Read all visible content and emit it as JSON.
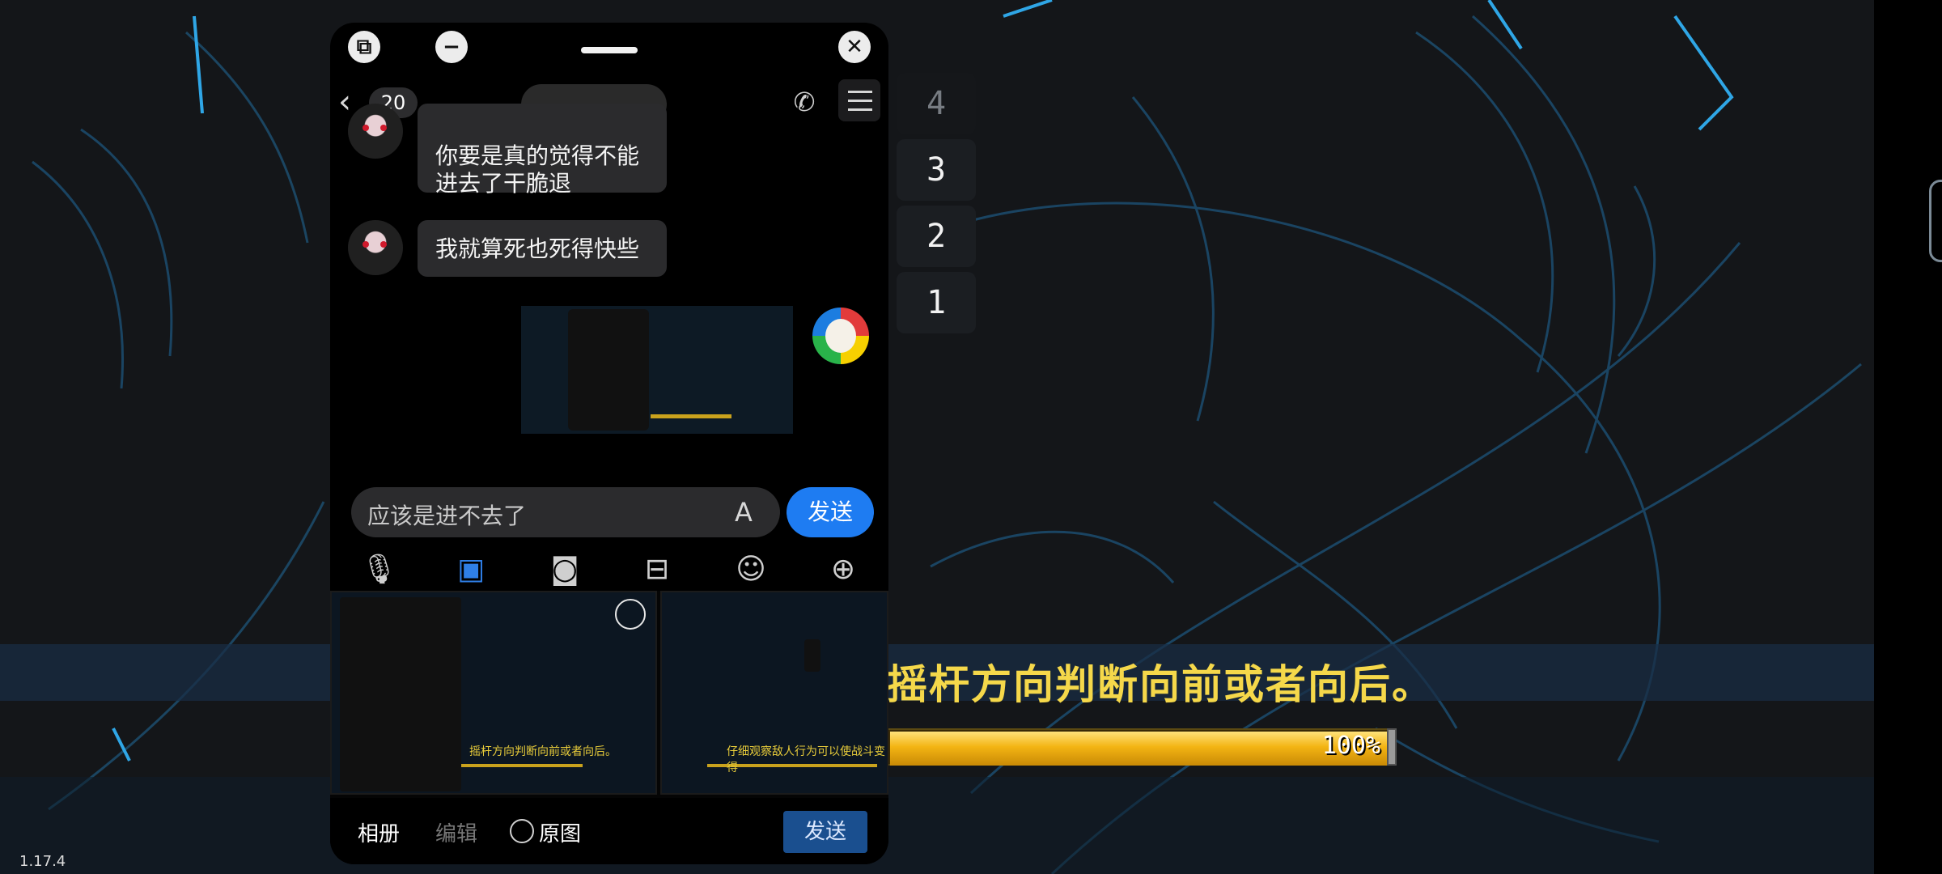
{
  "game": {
    "level_slots": [
      "4",
      "3",
      "2",
      "1"
    ],
    "subtitle": "摇杆方向判断向前或者向后。",
    "progress_percent": 100,
    "progress_label": "100%",
    "version": "1.17.4",
    "accent_color": "#f5d84a"
  },
  "chat": {
    "unread_count": "20",
    "icons": [
      "restore-icon",
      "minimize-icon",
      "close-icon",
      "back-icon",
      "phone-icon",
      "menu-icon"
    ],
    "messages": [
      {
        "side": "left",
        "text": "你要是真的觉得不能进去了干脆退"
      },
      {
        "side": "left",
        "text": "我就算死也死得快些"
      },
      {
        "side": "right",
        "type": "image"
      }
    ],
    "input": {
      "value": "应该是进不去了",
      "send_label": "发送"
    },
    "toolbar": [
      "mic-icon",
      "image-icon",
      "camera-icon",
      "gift-icon",
      "emoji-icon",
      "plus-icon"
    ],
    "gallery": {
      "thumb1_subtitle": "摇杆方向判断向前或者向后。",
      "thumb2_subtitle": "仔细观察敌人行为可以使战斗变得"
    },
    "bottom": {
      "album": "相册",
      "edit": "编辑",
      "original": "原图",
      "send": "发送"
    },
    "send_color": "#1e7cf2"
  }
}
